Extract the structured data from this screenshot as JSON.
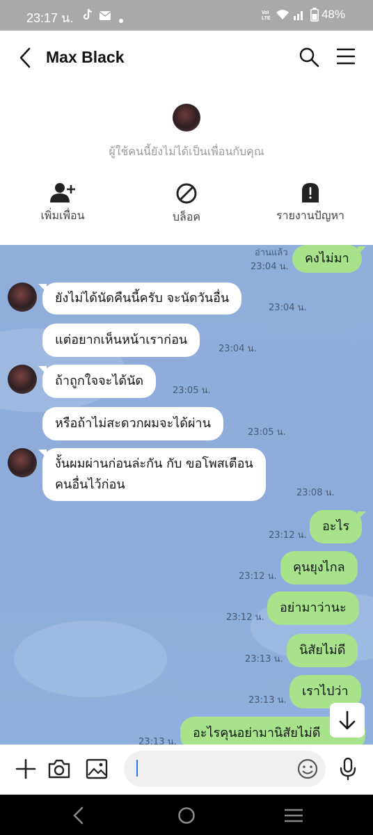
{
  "status_bar": {
    "time": "23:17 น.",
    "network": "VoLTE",
    "battery": "48%"
  },
  "header": {
    "title": "Max Black"
  },
  "friend_panel": {
    "notice": "ผู้ใช้คนนี้ยังไม่ได้เป็นเพื่อนกับคุณ",
    "actions": [
      {
        "label": "เพิ่มเพื่อน",
        "icon": "add-friend-icon"
      },
      {
        "label": "บล็อค",
        "icon": "block-icon"
      },
      {
        "label": "รายงานปัญหา",
        "icon": "report-icon"
      }
    ]
  },
  "chat": {
    "read_label": "อ่านแล้ว",
    "messages": [
      {
        "side": "out",
        "text": "คงไม่มา",
        "time": "23:04 น."
      },
      {
        "side": "in",
        "text": "ยังไม่ได้นัดคืนนี้ครับ จะนัดวันอื่น",
        "time": "23:04 น."
      },
      {
        "side": "in",
        "text": "แต่อยากเห็นหน้าเราก่อน",
        "time": "23:04 น."
      },
      {
        "side": "in",
        "text": "ถ้าถูกใจจะได้นัด",
        "time": "23:05 น."
      },
      {
        "side": "in",
        "text": "หรือถ้าไม่สะดวกผมจะได้ผ่าน",
        "time": "23:05 น."
      },
      {
        "side": "in",
        "text": "งั้นผมผ่านก่อนล่ะกัน กับ ขอโพสเตือน",
        "text2": "คนอื่นไว้ก่อน",
        "time": "23:08 น."
      },
      {
        "side": "out",
        "text": "อะไร",
        "time": "23:12 น."
      },
      {
        "side": "out",
        "text": "คุนยุงไกล",
        "time": "23:12 น."
      },
      {
        "side": "out",
        "text": "อย่ามาว่านะ",
        "time": "23:12 น."
      },
      {
        "side": "out",
        "text": "นิสัยไม่ดี",
        "time": "23:13 น."
      },
      {
        "side": "out",
        "text": "เราไปว่า",
        "time": "23:13 น."
      },
      {
        "side": "out",
        "text": "อะไรคุนอย่ามานิสัยไม่ดี",
        "time": "23:13 น."
      }
    ]
  },
  "input_bar": {
    "placeholder": ""
  },
  "colors": {
    "chat_bg": "#90aedc",
    "outgoing_bubble": "#a6e38a",
    "incoming_bubble": "#ffffff"
  }
}
